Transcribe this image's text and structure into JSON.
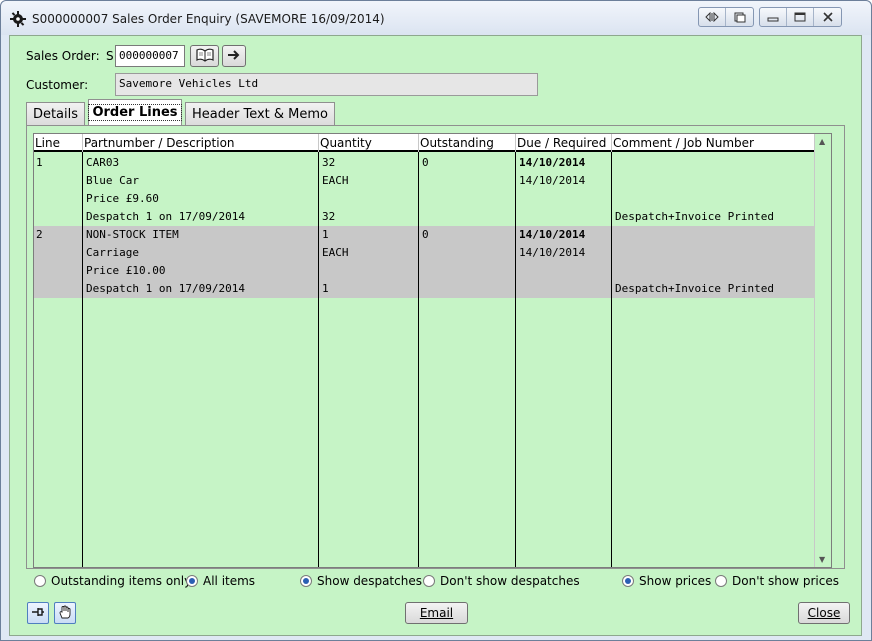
{
  "window": {
    "title": "S000000007 Sales Order Enquiry (SAVEMORE 16/09/2014)"
  },
  "form": {
    "sales_order_label": "Sales Order:",
    "sales_order_prefix": "S",
    "sales_order_value": "000000007",
    "customer_label": "Customer:",
    "customer_value": "Savemore Vehicles Ltd"
  },
  "tabs": [
    {
      "label": "Details",
      "active": false
    },
    {
      "label": "Order Lines",
      "active": true
    },
    {
      "label": "Header Text & Memo",
      "active": false
    }
  ],
  "grid": {
    "columns": [
      "Line",
      "Partnumber / Description",
      "Quantity",
      "Outstanding",
      "Due / Required",
      "Comment / Job Number"
    ],
    "rows": [
      {
        "band": "a",
        "line": "1",
        "part": "CAR03",
        "qty": "32",
        "outstanding": "0",
        "due": "14/10/2014",
        "comment": "",
        "bold_part": false,
        "bold_due": true
      },
      {
        "band": "a",
        "line": "",
        "part": "Blue Car",
        "qty": "EACH",
        "outstanding": "",
        "due": "14/10/2014",
        "comment": "",
        "bold_part": false,
        "bold_due": false
      },
      {
        "band": "a",
        "line": "",
        "part": "Price £9.60",
        "qty": "",
        "outstanding": "",
        "due": "",
        "comment": "",
        "bold_part": false,
        "bold_due": false
      },
      {
        "band": "a",
        "line": "",
        "part": "Despatch 1 on 17/09/2014",
        "qty": "32",
        "outstanding": "",
        "due": "",
        "comment": "Despatch+Invoice Printed",
        "bold_part": false,
        "bold_due": false
      },
      {
        "band": "b",
        "line": "2",
        "part": "NON-STOCK ITEM",
        "qty": "1",
        "outstanding": "0",
        "due": "14/10/2014",
        "comment": "",
        "bold_part": false,
        "bold_due": true
      },
      {
        "band": "b",
        "line": "",
        "part": "Carriage",
        "qty": "EACH",
        "outstanding": "",
        "due": "14/10/2014",
        "comment": "",
        "bold_part": false,
        "bold_due": false
      },
      {
        "band": "b",
        "line": "",
        "part": "Price £10.00",
        "qty": "",
        "outstanding": "",
        "due": "",
        "comment": "",
        "bold_part": false,
        "bold_due": false
      },
      {
        "band": "b",
        "line": "",
        "part": "Despatch 1 on 17/09/2014",
        "qty": "1",
        "outstanding": "",
        "due": "",
        "comment": "Despatch+Invoice Printed",
        "bold_part": false,
        "bold_due": false
      }
    ]
  },
  "options": {
    "outstanding_only": "Outstanding items only",
    "all_items": "All items",
    "show_despatches": "Show despatches",
    "dont_show_despatches": "Don't show despatches",
    "show_prices": "Show prices",
    "dont_show_prices": "Don't show prices",
    "selected_items": "all_items",
    "selected_despatch": "show_despatches",
    "selected_prices": "show_prices"
  },
  "footer": {
    "email_label": "Email",
    "close_label": "Close"
  },
  "icons": {
    "app": "app-gear-icon",
    "lookup": "book-icon",
    "go": "arrow-right-icon",
    "pin": "pin-icon",
    "hand": "hand-icon"
  }
}
